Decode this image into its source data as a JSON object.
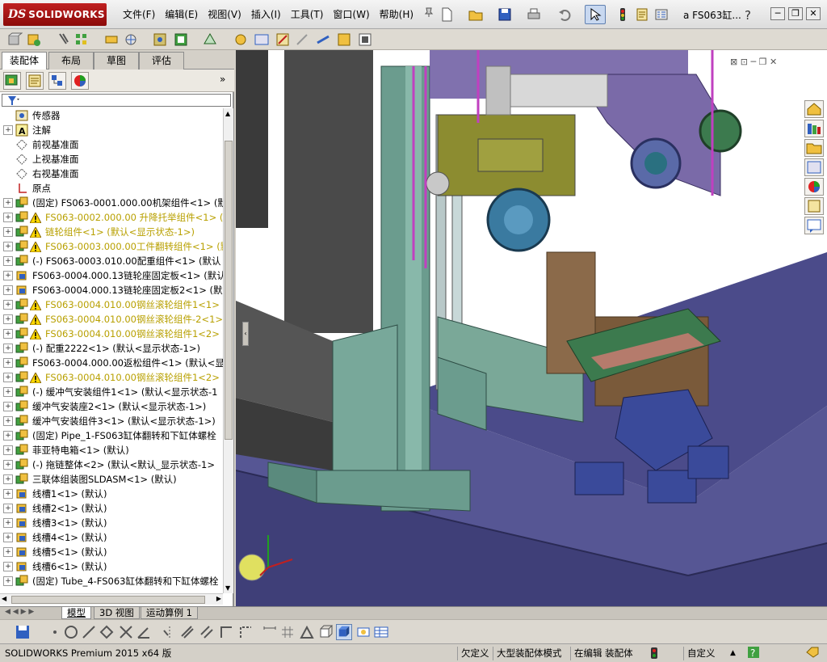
{
  "app": {
    "logo_ds": "DS",
    "logo_name": "SOLIDWORKS",
    "document_title": "a  FS063缸..."
  },
  "menu": [
    "文件(F)",
    "编辑(E)",
    "视图(V)",
    "插入(I)",
    "工具(T)",
    "窗口(W)",
    "帮助(H)"
  ],
  "panel_tabs": [
    "装配体",
    "布局",
    "草图",
    "评估"
  ],
  "panel_tabs_active": 0,
  "tree": [
    {
      "label": "传感器",
      "icon": "sensor-icon",
      "expander": "none",
      "warn": false
    },
    {
      "label": "注解",
      "icon": "annotation-icon",
      "expander": "plus",
      "warn": false
    },
    {
      "label": "前视基准面",
      "icon": "plane-icon",
      "expander": "none",
      "warn": false
    },
    {
      "label": "上视基准面",
      "icon": "plane-icon",
      "expander": "none",
      "warn": false
    },
    {
      "label": "右视基准面",
      "icon": "plane-icon",
      "expander": "none",
      "warn": false
    },
    {
      "label": "原点",
      "icon": "origin-icon",
      "expander": "none",
      "warn": false
    },
    {
      "label": "(固定) FS063-0001.000.00机架组件<1> (默",
      "icon": "assembly-icon",
      "expander": "plus",
      "warn": false
    },
    {
      "label": "FS063-0002.000.00 升降托举组件<1> (默",
      "icon": "assembly-icon",
      "expander": "plus",
      "warn": true
    },
    {
      "label": "链轮组件<1> (默认<显示状态-1>)",
      "icon": "assembly-icon",
      "expander": "plus",
      "warn": true
    },
    {
      "label": "FS063-0003.000.00工件翻转组件<1> (默",
      "icon": "assembly-icon",
      "expander": "plus",
      "warn": true
    },
    {
      "label": "(-) FS063-0003.010.00配重组件<1> (默认",
      "icon": "assembly-icon",
      "expander": "plus",
      "warn": false
    },
    {
      "label": "FS063-0004.000.13链轮座固定板<1> (默认",
      "icon": "part-icon",
      "expander": "plus",
      "warn": false
    },
    {
      "label": "FS063-0004.000.13链轮座固定板2<1> (默认",
      "icon": "part-icon",
      "expander": "plus",
      "warn": false
    },
    {
      "label": "FS063-0004.010.00钢丝滚轮组件1<1> (默",
      "icon": "assembly-icon",
      "expander": "plus",
      "warn": true
    },
    {
      "label": "FS063-0004.010.00钢丝滚轮组件-2<1> (默",
      "icon": "assembly-icon",
      "expander": "plus",
      "warn": true
    },
    {
      "label": "FS063-0004.010.00钢丝滚轮组件1<2> (默",
      "icon": "assembly-icon",
      "expander": "plus",
      "warn": true
    },
    {
      "label": "(-) 配重2222<1> (默认<显示状态-1>)",
      "icon": "assembly-icon",
      "expander": "plus",
      "warn": false
    },
    {
      "label": "FS063-0004.000.00返松组件<1> (默认<显示",
      "icon": "assembly-icon",
      "expander": "plus",
      "warn": false
    },
    {
      "label": "FS063-0004.010.00钢丝滚轮组件1<2> (默",
      "icon": "assembly-icon",
      "expander": "plus",
      "warn": true
    },
    {
      "label": "(-) 缓冲气安装组件1<1> (默认<显示状态-1",
      "icon": "assembly-icon",
      "expander": "plus",
      "warn": false
    },
    {
      "label": "缓冲气安装座2<1> (默认<显示状态-1>)",
      "icon": "assembly-icon",
      "expander": "plus",
      "warn": false
    },
    {
      "label": "缓冲气安装组件3<1> (默认<显示状态-1>)",
      "icon": "assembly-icon",
      "expander": "plus",
      "warn": false
    },
    {
      "label": "(固定) Pipe_1-FS063缸体翻转和下缸体螺栓",
      "icon": "assembly-icon",
      "expander": "plus",
      "warn": false
    },
    {
      "label": "菲亚特电箱<1> (默认)",
      "icon": "assembly-icon",
      "expander": "plus",
      "warn": false
    },
    {
      "label": "(-) 拖链整体<2> (默认<默认_显示状态-1>",
      "icon": "assembly-icon",
      "expander": "plus",
      "warn": false
    },
    {
      "label": "三联体组装图SLDASM<1> (默认)",
      "icon": "assembly-icon",
      "expander": "plus",
      "warn": false
    },
    {
      "label": "线槽1<1> (默认)",
      "icon": "part-icon",
      "expander": "plus",
      "warn": false
    },
    {
      "label": "线槽2<1> (默认)",
      "icon": "part-icon",
      "expander": "plus",
      "warn": false
    },
    {
      "label": "线槽3<1> (默认)",
      "icon": "part-icon",
      "expander": "plus",
      "warn": false
    },
    {
      "label": "线槽4<1> (默认)",
      "icon": "part-icon",
      "expander": "plus",
      "warn": false
    },
    {
      "label": "线槽5<1> (默认)",
      "icon": "part-icon",
      "expander": "plus",
      "warn": false
    },
    {
      "label": "线槽6<1> (默认)",
      "icon": "part-icon",
      "expander": "plus",
      "warn": false
    },
    {
      "label": "(固定) Tube_4-FS063缸体翻转和下缸体螺栓",
      "icon": "assembly-icon",
      "expander": "plus",
      "warn": false
    }
  ],
  "bottom_tabs": [
    "模型",
    "3D 视图",
    "运动算例 1"
  ],
  "status": {
    "product": "SOLIDWORKS Premium 2015 x64 版",
    "under_defined": "欠定义",
    "large_assembly": "大型装配体模式",
    "editing": "在编辑 装配体",
    "custom": "自定义"
  },
  "colors": {
    "warning": "#b8a000",
    "viewport_floor": "#4a4a8c",
    "column": "#6b9c8e"
  }
}
